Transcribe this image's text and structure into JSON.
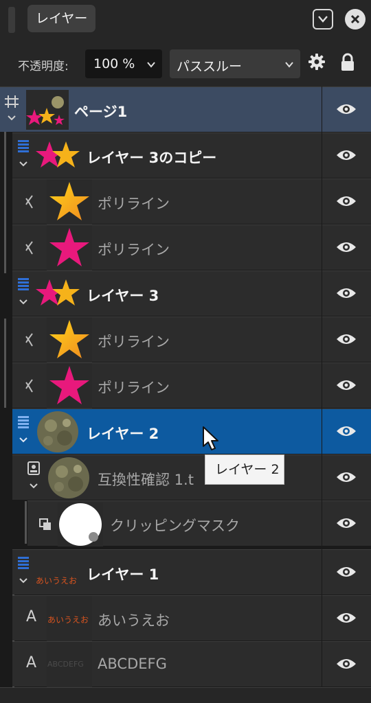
{
  "panel": {
    "tab_label": "レイヤー",
    "opacity_label": "不透明度:",
    "opacity_value": "100 %",
    "blend_mode": "パススルー"
  },
  "layers": [
    {
      "name": "ページ1",
      "type": "page"
    },
    {
      "name": "レイヤー 3のコピー",
      "type": "layer"
    },
    {
      "name": "ポリライン",
      "type": "polyline"
    },
    {
      "name": "ポリライン",
      "type": "polyline"
    },
    {
      "name": "レイヤー 3",
      "type": "layer"
    },
    {
      "name": "ポリライン",
      "type": "polyline"
    },
    {
      "name": "ポリライン",
      "type": "polyline"
    },
    {
      "name": "レイヤー 2",
      "type": "layer",
      "selected": true
    },
    {
      "name": "互換性確認 1.t",
      "type": "image"
    },
    {
      "name": "クリッピングマスク",
      "type": "mask"
    },
    {
      "name": "レイヤー 1",
      "type": "layer"
    },
    {
      "name": "あいうえお",
      "type": "text"
    },
    {
      "name": "ABCDEFG",
      "type": "text"
    }
  ],
  "thumbs": {
    "text1": "あいうえお",
    "text2": "ABCDEFG"
  },
  "tooltip": "レイヤー 2",
  "colors": {
    "selected": "#0d5aa0",
    "page_row": "#3c4b62",
    "star_gold": "#f6b21a",
    "star_pink": "#e8197c"
  }
}
